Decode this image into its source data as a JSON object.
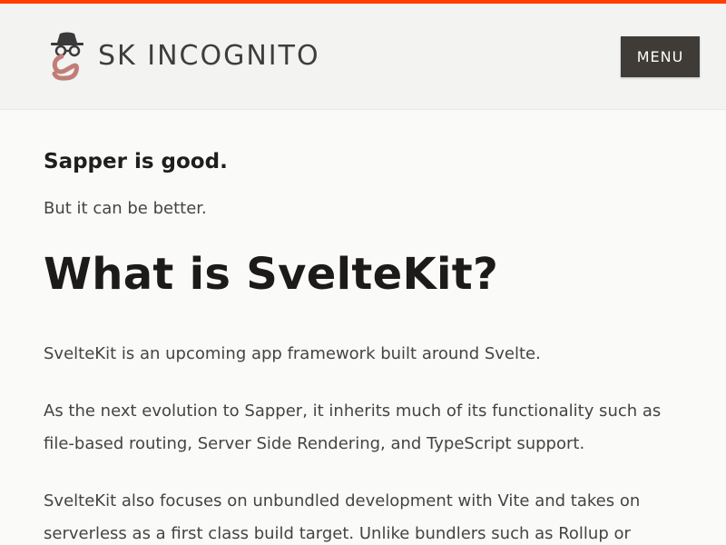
{
  "colors": {
    "accent": "#ff3e00",
    "header_bg": "#f3f3f2",
    "menu_bg": "#3f3b36",
    "logo_swirl": "#c07e77"
  },
  "header": {
    "logo_icon": "incognito-svelte-logo-icon",
    "brand": "SK INCOGNITO",
    "menu_label": "MENU"
  },
  "content": {
    "lead": "Sapper is good.",
    "sub": "But it can be better.",
    "heading": "What is SvelteKit?",
    "paragraphs": [
      "SvelteKit is an upcoming app framework built around Svelte.",
      "As the next evolution to Sapper, it inherits much of its functionality such as file-based routing, Server Side Rendering, and TypeScript support.",
      "SvelteKit also focuses on unbundled development with Vite and takes on serverless as a first class build target. Unlike bundlers such as Rollup or"
    ]
  }
}
